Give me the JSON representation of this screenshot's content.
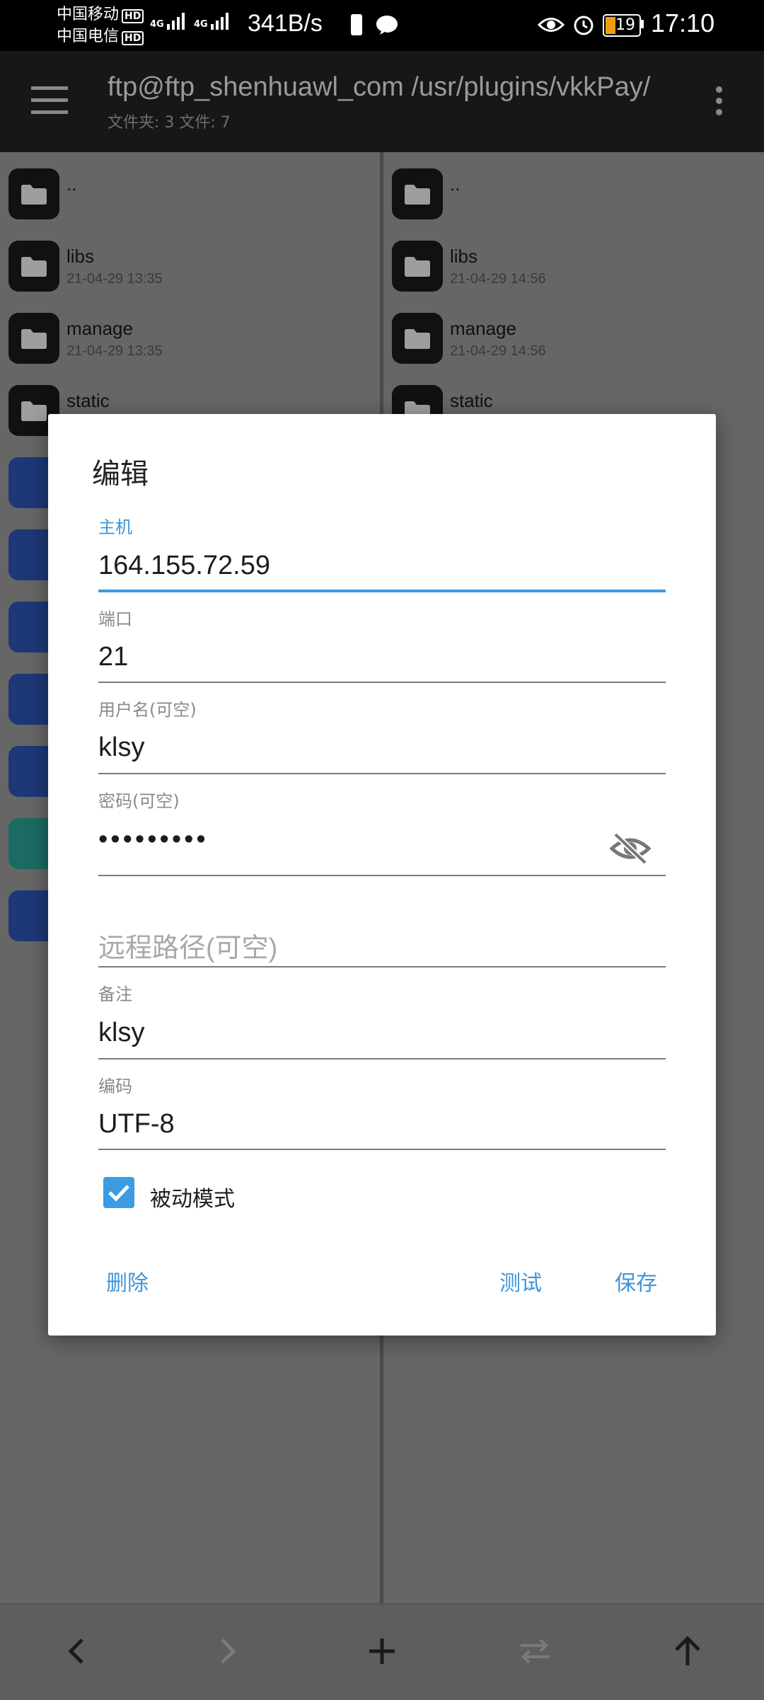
{
  "status": {
    "carrier1": "中国移动",
    "carrier2": "中国电信",
    "hd": "HD",
    "net1": "4G",
    "net2": "4G",
    "speed": "341B/s",
    "battery": "19",
    "time": "17:10"
  },
  "toolbar": {
    "title": "ftp@ftp_shenhuawl_com /usr/plugins/vkkPay/",
    "subtitle": "文件夹: 3  文件: 7"
  },
  "left_pane": {
    "items": [
      {
        "name": "..",
        "date": ""
      },
      {
        "name": "libs",
        "date": "21-04-29 13:35"
      },
      {
        "name": "manage",
        "date": "21-04-29 13:35"
      },
      {
        "name": "static",
        "date": ""
      }
    ],
    "icons": [
      "doc-icon",
      "doc-icon",
      "doc-icon",
      "doc-icon",
      "doc-icon",
      "image-icon",
      "doc-icon"
    ]
  },
  "right_pane": {
    "items": [
      {
        "name": "..",
        "date": ""
      },
      {
        "name": "libs",
        "date": "21-04-29 14:56"
      },
      {
        "name": "manage",
        "date": "21-04-29 14:56"
      },
      {
        "name": "static",
        "date": ""
      }
    ]
  },
  "dialog": {
    "title": "编辑",
    "host_label": "主机",
    "host_value": "164.155.72.59",
    "port_label": "端口",
    "port_value": "21",
    "user_label": "用户名(可空)",
    "user_value": "klsy",
    "password_label": "密码(可空)",
    "password_value": "•••••••••",
    "remote_path_placeholder": "远程路径(可空)",
    "note_label": "备注",
    "note_value": "klsy",
    "encoding_label": "编码",
    "encoding_value": "UTF-8",
    "passive_label": "被动模式",
    "passive_checked": true,
    "delete_label": "删除",
    "test_label": "测试",
    "save_label": "保存"
  },
  "colors": {
    "accent": "#3b9be3",
    "toolbar_bg": "#171717",
    "dim_overlay": "#666666",
    "doc_icon": "#1d3777",
    "image_icon": "#1b6b63"
  }
}
